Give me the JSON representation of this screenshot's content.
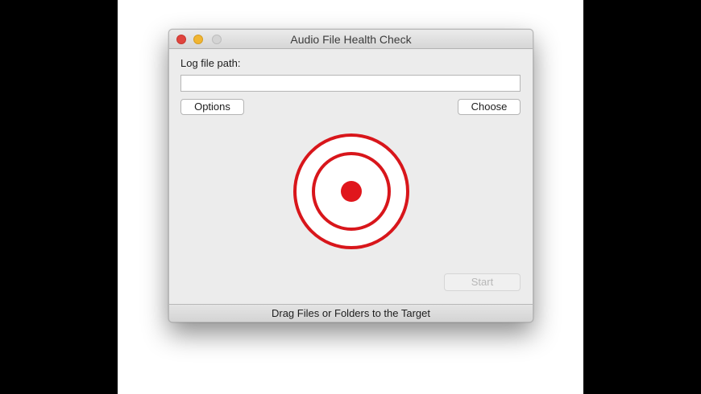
{
  "window": {
    "title": "Audio File Health Check"
  },
  "form": {
    "log_label": "Log file path:",
    "log_path_value": "",
    "options_label": "Options",
    "choose_label": "Choose",
    "start_label": "Start"
  },
  "status": {
    "text": "Drag Files or Folders to the Target"
  },
  "icons": {
    "target": "drop-target-icon"
  },
  "colors": {
    "target_red": "#e0161c",
    "close": "#e0443e",
    "minimize": "#f1b532",
    "zoom_disabled": "#d4d4d4"
  }
}
